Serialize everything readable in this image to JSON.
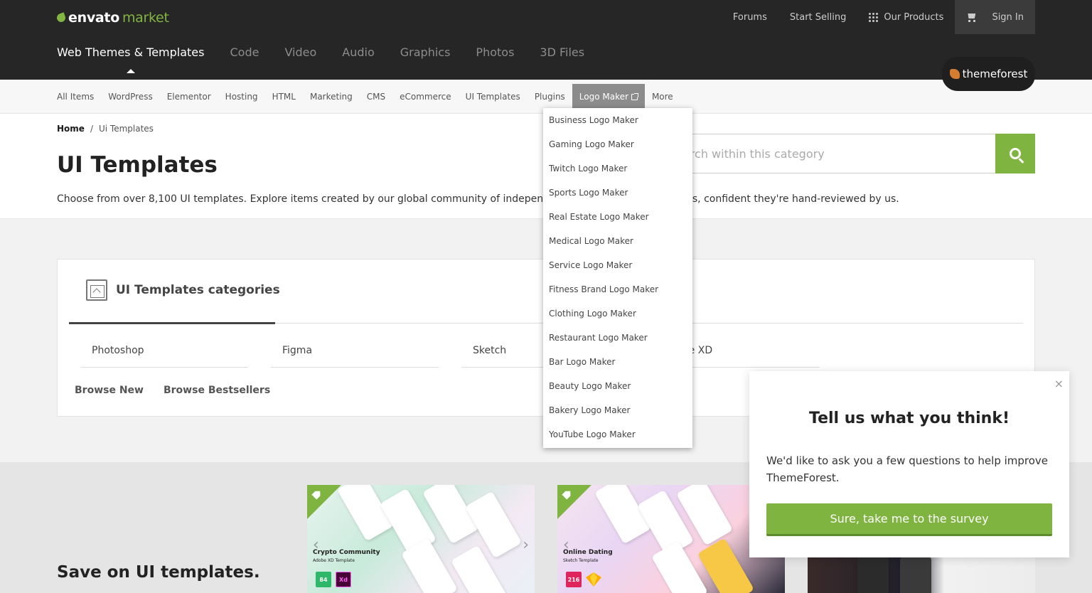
{
  "brand": {
    "word1": "envato",
    "word2": "market"
  },
  "utility": {
    "forums": "Forums",
    "start_selling": "Start Selling",
    "our_products": "Our Products",
    "sign_in": "Sign In"
  },
  "categories": [
    "Web Themes & Templates",
    "Code",
    "Video",
    "Audio",
    "Graphics",
    "Photos",
    "3D Files"
  ],
  "themeforest_badge": "themeforest",
  "subnav": [
    "All Items",
    "WordPress",
    "Elementor",
    "Hosting",
    "HTML",
    "Marketing",
    "CMS",
    "eCommerce",
    "UI Templates",
    "Plugins",
    "Logo Maker",
    "More"
  ],
  "dropdown": [
    "Business Logo Maker",
    "Gaming Logo Maker",
    "Twitch Logo Maker",
    "Sports Logo Maker",
    "Real Estate Logo Maker",
    "Medical Logo Maker",
    "Service Logo Maker",
    "Fitness Brand Logo Maker",
    "Clothing Logo Maker",
    "Restaurant Logo Maker",
    "Bar Logo Maker",
    "Beauty Logo Maker",
    "Bakery Logo Maker",
    "YouTube Logo Maker"
  ],
  "breadcrumb": {
    "home": "Home",
    "sep": "/",
    "current": "Ui Templates"
  },
  "page_title": "UI Templates",
  "description": "Choose from over 8,100 UI templates. Explore items created by our global community of independent designers and developers, confident they're hand-reviewed by us.",
  "search": {
    "placeholder": "Search within this category"
  },
  "panel": {
    "title": "UI Templates categories",
    "items": [
      "Photoshop",
      "Figma",
      "Sketch",
      "Adobe XD"
    ],
    "browse_new": "Browse New",
    "browse_bestsellers": "Browse Bestsellers"
  },
  "save_heading": "Save on UI templates.",
  "cards": [
    {
      "title": "Crypto Community",
      "sub": "Adobe XD Template",
      "count": "84",
      "app": "Xd"
    },
    {
      "title": "Online Dating",
      "sub": "Sketch Template",
      "count": "216",
      "app": ""
    }
  ],
  "survey": {
    "close": "×",
    "title": "Tell us what you think!",
    "body": "We'd like to ask you a few questions to help improve ThemeForest.",
    "cta": "Sure, take me to the survey"
  },
  "colors": {
    "accent": "#7eb43f",
    "header": "#262626"
  }
}
